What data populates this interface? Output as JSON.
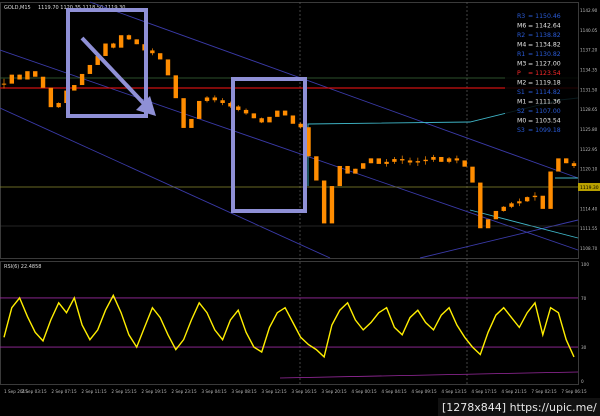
{
  "header": {
    "symbol_label": "GOLD,M15",
    "ohlc": "1119.70 1120.35 1118.50 1119.30"
  },
  "rsi_label": "RSI(6) 22.4858",
  "watermark": "[1278x844] https://upic.me/",
  "pivots": [
    {
      "label": "R3",
      "value": "1150.46",
      "color": "#2a5bd7"
    },
    {
      "label": "M6",
      "value": "1142.64",
      "color": "#e8e8e8"
    },
    {
      "label": "R2",
      "value": "1138.82",
      "color": "#2a5bd7"
    },
    {
      "label": "M4",
      "value": "1134.82",
      "color": "#e8e8e8"
    },
    {
      "label": "R1",
      "value": "1130.82",
      "color": "#2a5bd7"
    },
    {
      "label": "M3",
      "value": "1127.00",
      "color": "#e8e8e8"
    },
    {
      "label": "P",
      "value": "1123.54",
      "color": "#ff2a2a"
    },
    {
      "label": "M2",
      "value": "1119.18",
      "color": "#e8e8e8"
    },
    {
      "label": "S1",
      "value": "1114.82",
      "color": "#2a5bd7"
    },
    {
      "label": "M1",
      "value": "1111.36",
      "color": "#e8e8e8"
    },
    {
      "label": "S2",
      "value": "1107.00",
      "color": "#2a5bd7"
    },
    {
      "label": "M0",
      "value": "1103.54",
      "color": "#e8e8e8"
    },
    {
      "label": "S3",
      "value": "1099.18",
      "color": "#2a5bd7"
    }
  ],
  "price_axis": [
    "1142.90",
    "1140.05",
    "1137.20",
    "1134.35",
    "1131.50",
    "1128.65",
    "1125.80",
    "1122.95",
    "1120.10",
    "1117.25",
    "1114.40",
    "1111.55",
    "1108.70"
  ],
  "price_tag": "1119.30",
  "rsi_axis": [
    "100",
    "70",
    "30",
    "0"
  ],
  "time_axis": [
    "1 Sep 2015",
    "2 Sep 03:15",
    "2 Sep 07:15",
    "2 Sep 11:15",
    "2 Sep 15:15",
    "2 Sep 19:15",
    "2 Sep 23:15",
    "3 Sep 04:15",
    "3 Sep 08:15",
    "3 Sep 12:15",
    "3 Sep 16:15",
    "3 Sep 20:15",
    "4 Sep 00:15",
    "4 Sep 04:15",
    "4 Sep 09:15",
    "4 Sep 13:15",
    "4 Sep 17:15",
    "4 Sep 21:15",
    "7 Sep 02:15",
    "7 Sep 06:15"
  ],
  "colors": {
    "up": "#ff8c00",
    "grid": "#1e1e2a",
    "pivot_line": "#cc1010",
    "annot": "#8f90d6",
    "channel": "#3a3aa8",
    "cyan": "#3fb6c8",
    "rsi": "#ffee00",
    "rsi_level": "#9a2aa0"
  },
  "chart_data": {
    "type": "line",
    "title": "GOLD,M15",
    "series": [
      {
        "name": "GOLD,M15",
        "values": [
          1131.2,
          1132.5,
          1131.8,
          1133.0,
          1132.2,
          1130.6,
          1127.8,
          1128.4,
          1130.2,
          1131.0,
          1132.6,
          1133.9,
          1135.2,
          1137.0,
          1136.4,
          1138.2,
          1137.6,
          1136.9,
          1136.0,
          1135.6,
          1134.7,
          1132.4,
          1129.1,
          1124.8,
          1126.1,
          1128.7,
          1129.2,
          1128.8,
          1128.4,
          1127.9,
          1127.4,
          1126.9,
          1126.2,
          1125.6,
          1126.4,
          1127.3,
          1126.6,
          1125.4,
          1124.9,
          1120.7,
          1117.2,
          1111.0,
          1116.4,
          1119.3,
          1118.2,
          1118.9,
          1119.7,
          1120.4,
          1119.6,
          1119.9,
          1120.3,
          1120.1,
          1119.8,
          1120.0,
          1120.2,
          1120.6,
          1119.9,
          1120.4,
          1120.1,
          1119.2,
          1116.9,
          1110.3,
          1111.6,
          1112.8,
          1113.4,
          1113.9,
          1114.2,
          1114.8,
          1115.0,
          1113.1,
          1118.5,
          1120.4,
          1119.7,
          1119.3
        ]
      }
    ],
    "rsi": {
      "name": "RSI(6)",
      "value": 22.4858,
      "levels": [
        70,
        30
      ],
      "range": [
        0,
        100
      ],
      "values": [
        38,
        62,
        70,
        55,
        42,
        35,
        52,
        66,
        58,
        70,
        48,
        36,
        44,
        60,
        72,
        58,
        40,
        30,
        46,
        62,
        54,
        40,
        28,
        36,
        52,
        66,
        58,
        44,
        36,
        52,
        60,
        42,
        30,
        26,
        46,
        58,
        62,
        50,
        38,
        32,
        28,
        22,
        48,
        60,
        66,
        52,
        44,
        50,
        58,
        62,
        46,
        40,
        54,
        60,
        50,
        44,
        56,
        62,
        48,
        38,
        30,
        24,
        42,
        56,
        62,
        54,
        46,
        58,
        66,
        40,
        62,
        58,
        36,
        22
      ]
    },
    "ylim": [
      1106,
      1143
    ],
    "grid": false
  }
}
